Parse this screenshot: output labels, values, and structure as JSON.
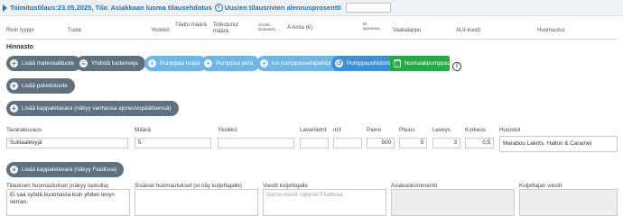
{
  "header": {
    "title": "Toimitustilaus:23.05.2025, Tila: Asiakkaan luoma tilausehdotus",
    "new_discount_label": "Uusien tilausrivien alennusprosentti",
    "discount_value": ""
  },
  "columns": {
    "row_type": "Rivin tyyppi",
    "product": "Tuote",
    "unit": "Yksikkö",
    "ordered_qty": "Tilattu määrä",
    "realized_qty": "Toteutunut määrä",
    "agreed_price": "Sovittu laskutush...",
    "unit_price": "A-hinta (€)",
    "ajoneuvo": "El ajoneuvo...",
    "scale": "Vaakalappu",
    "vat": "ALV-koodi",
    "note": "Huomautus"
  },
  "pricing": {
    "section_label": "Hinnasto",
    "buttons": {
      "add_material": "Lisää materiaalituote",
      "combine": "Yhdistä tuoteriveja",
      "pump_nozzle": "Pumppaa nuppi",
      "pump_rear": "Pumppaa perä",
      "new_pump_event": "luo pumppausetapahtuma",
      "pump_history": "Pumppaushistoria",
      "normal_pump": "Normaalipumppaus",
      "add_service": "Lisää palvelutuote",
      "add_piece_goods": "Lisää kappaletavara (näkyy vanhassa ajoneuvopäätteessä)",
      "add_piece_goods_fluid": "Lisää kappaletavara (näkyy Fluidissa)"
    }
  },
  "piece_goods": {
    "labels": {
      "description": "Tavarakuvaus",
      "quantity": "Määrä",
      "unit": "Yksikkö",
      "pallet_meters": "Lavametrit",
      "m3": "m3",
      "weight": "Paino",
      "length": "Pituus",
      "width": "Leveys",
      "height": "Korkeus",
      "notes": "Huomiot"
    },
    "values": {
      "description": "Suklaalevyjä",
      "quantity": "5",
      "unit": "",
      "pallet_meters": "",
      "m3": "",
      "weight": "500",
      "length": "5",
      "width": "3",
      "height": "0,5",
      "notes": "Marabou Lakrits, Hallon & Caramel"
    }
  },
  "notes": {
    "order_note_label": "Tilauksen huomautukset (näkyy laskulla)",
    "order_note_value": "Ei saa syödä kuormasta kuin yhden levyn verran.",
    "internal_note_label": "Sisäiset huomautukset (ei näy kuljettajalle)",
    "internal_note_value": "",
    "driver_msg_label": "Viestit kuljettajalle",
    "driver_msg_placeholder": "Nämä viestit näkyvät Fluidissa",
    "customer_comment_label": "Asiakaskommentti",
    "customer_comment_value": "",
    "driver_note_label": "Kuljettajan viestit",
    "driver_note_value": ""
  }
}
